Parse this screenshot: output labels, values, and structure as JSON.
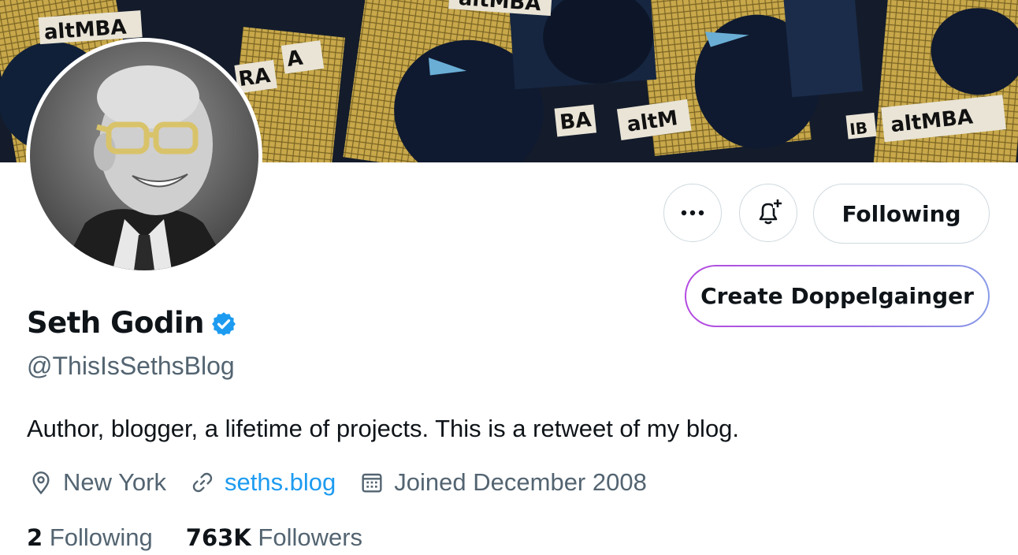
{
  "banner": {
    "patch_texts": [
      "altMBA",
      "altMBA",
      "altMBA",
      "altMBA",
      "BA",
      "altM",
      "IB",
      "A",
      "RA",
      "altMBA"
    ]
  },
  "actions": {
    "more_icon": "more-icon",
    "notify_icon": "bell-plus-icon",
    "following_label": "Following",
    "doppel_label": "Create Doppelgainger"
  },
  "profile": {
    "name": "Seth Godin",
    "handle": "@ThisIsSethsBlog",
    "bio": "Author, blogger, a lifetime of projects. This is a retweet of my blog.",
    "location": "New York",
    "website": "seths.blog",
    "joined": "Joined December 2008",
    "following_count": "2",
    "following_label": "Following",
    "followers_count": "763K",
    "followers_label": "Followers"
  },
  "colors": {
    "link": "#1d9bf0",
    "verified": "#1d9bf0",
    "text_primary": "#0f1419",
    "text_secondary": "#536471"
  }
}
